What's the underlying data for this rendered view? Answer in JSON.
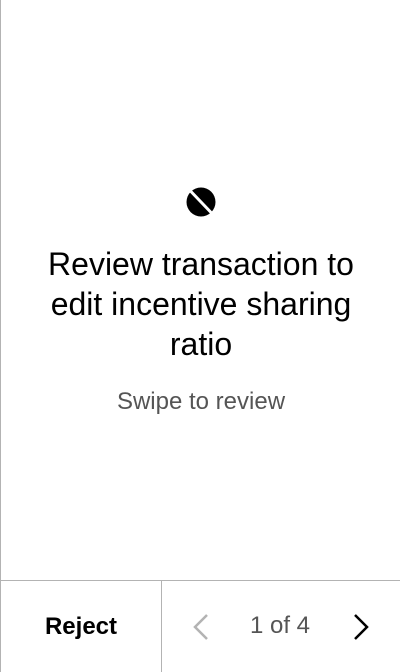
{
  "review": {
    "icon": "no-entry-icon",
    "title": "Review transaction to edit incentive sharing ratio",
    "subtitle": "Swipe to review"
  },
  "footer": {
    "reject_label": "Reject",
    "prev_icon": "chevron-left-icon",
    "next_icon": "chevron-right-icon",
    "page_indicator": "1 of 4",
    "current_page": 1,
    "total_pages": 4,
    "prev_enabled": false,
    "next_enabled": true
  },
  "colors": {
    "text": "#000000",
    "secondary_text": "#555555",
    "divider": "#b3b3b3",
    "disabled_arrow": "#b3b3b3",
    "background": "#ffffff"
  }
}
